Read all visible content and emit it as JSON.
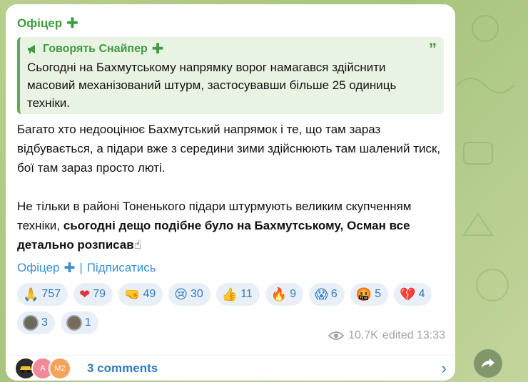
{
  "post": {
    "author": "Офіцер",
    "forward": {
      "source": "Говорять Снайпер",
      "text": "Сьогодні на Бахмутському напрямку ворог намагався здійснити масовий механізований штурм, застосувавши більше 25 одиниць техніки."
    },
    "body": {
      "para1": "Багато хто недооцінює Бахмутський напрямок і те, що там зараз відбувається, а підари вже з середини зими здійснюють там шалений тиск, бої там зараз просто люті.",
      "para2_normal": "Не тільки в районі Тоненького підари  штурмують великим скупченням техніки, ",
      "para2_bold": "сьогодні дещо подібне було на Бахмутському, Осман все детально розписав",
      "para2_emoji": "☝"
    },
    "signature": {
      "author": "Офіцер",
      "separator": "|",
      "subscribe": "Підписатись"
    },
    "reactions": [
      {
        "emoji": "🙏",
        "count": "757"
      },
      {
        "emoji": "❤",
        "count": "79"
      },
      {
        "emoji": "🤜",
        "count": "49"
      },
      {
        "emoji": "😢",
        "count": "30"
      },
      {
        "emoji": "👍",
        "count": "11"
      },
      {
        "emoji": "🔥",
        "count": "9"
      },
      {
        "emoji": "😱",
        "count": "6"
      },
      {
        "emoji": "🤬",
        "count": "5"
      },
      {
        "emoji": "💔",
        "count": "4"
      },
      {
        "emoji": "",
        "count": "3"
      },
      {
        "emoji": "",
        "count": "1"
      }
    ],
    "views": "10.7K",
    "edited": "edited 13:33",
    "comments": {
      "label": "3 comments",
      "avatars": [
        "",
        "A",
        "M2"
      ],
      "avatar_colors": [
        "#2b2b2b",
        "#f08a9a",
        "#f5a35b"
      ]
    }
  }
}
